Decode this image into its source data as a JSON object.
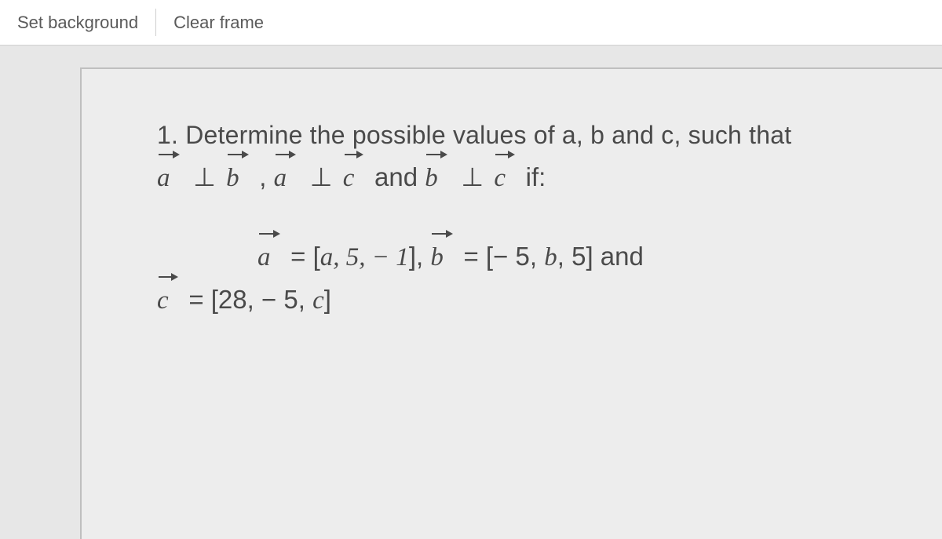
{
  "toolbar": {
    "set_background_label": "Set background",
    "clear_frame_label": "Clear frame"
  },
  "problem": {
    "prefix": "1. ",
    "intro": "Determine the possible values of a, b and c, such that",
    "cond_a": "a",
    "cond_perp1": " ⊥ ",
    "cond_b": "b",
    "cond_comma": " , ",
    "cond_a2": "a",
    "cond_perp2": " ⊥ ",
    "cond_c": "c",
    "cond_and": " and ",
    "cond_b2": "b",
    "cond_perp3": " ⊥ ",
    "cond_c2": "c",
    "cond_if": " if:",
    "def_a_v": "a",
    "def_a_eq": " = [",
    "def_a_body": "a, 5, − 1",
    "def_a_close": "], ",
    "def_b_v": "b",
    "def_b_eq": " = [− 5, ",
    "def_b_body": "b",
    "def_b_close": ", 5]  ",
    "def_and": "and",
    "def_c_v": "c",
    "def_c_eq": " = [28, − 5, ",
    "def_c_body": "c",
    "def_c_close": "]"
  }
}
